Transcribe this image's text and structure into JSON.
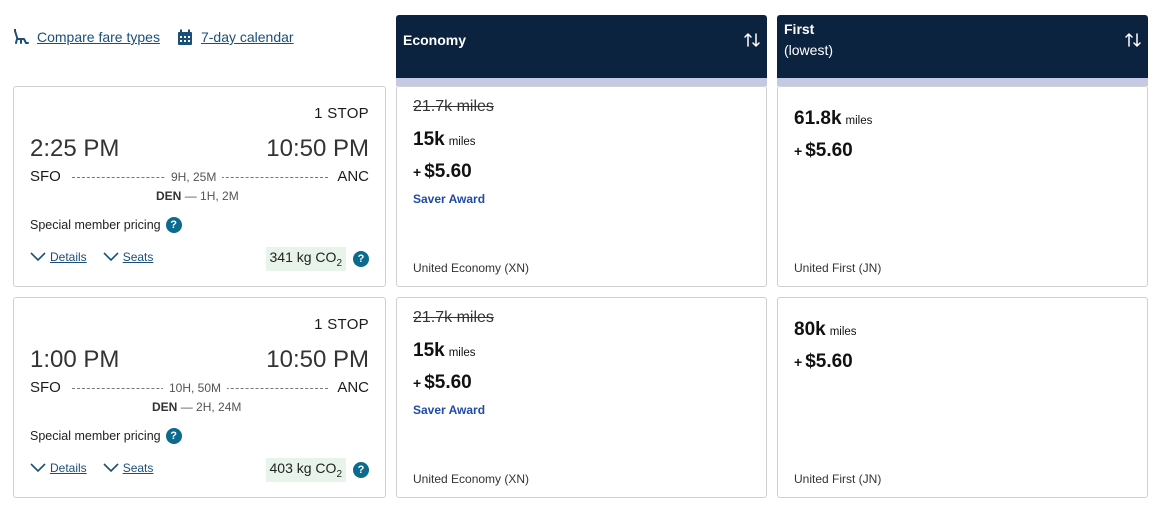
{
  "top_links": {
    "compare_fare_types": "Compare fare types",
    "seven_day_calendar": "7-day calendar"
  },
  "columns": {
    "economy": {
      "title": "Economy",
      "subtitle": ""
    },
    "first": {
      "title": "First",
      "subtitle": "(lowest)"
    }
  },
  "flights": [
    {
      "stops": "1 STOP",
      "depart_time": "2:25 PM",
      "arrive_time": "10:50 PM",
      "origin": "SFO",
      "destination": "ANC",
      "duration": "9H, 25M",
      "layover_airport": "DEN",
      "layover_duration": "— 1H, 2M",
      "special_pricing": "Special member pricing",
      "details_label": "Details",
      "seats_label": "Seats",
      "co2_value": "341 kg CO",
      "co2_sub": "2",
      "economy": {
        "original_miles": "21.7k miles",
        "miles": "15k",
        "miles_unit": "miles",
        "taxes": "$5.60",
        "badge": "Saver Award",
        "cabin": "United Economy (XN)"
      },
      "first": {
        "miles": "61.8k",
        "miles_unit": "miles",
        "taxes": "$5.60",
        "cabin": "United First (JN)"
      }
    },
    {
      "stops": "1 STOP",
      "depart_time": "1:00 PM",
      "arrive_time": "10:50 PM",
      "origin": "SFO",
      "destination": "ANC",
      "duration": "10H, 50M",
      "layover_airport": "DEN",
      "layover_duration": "— 2H, 24M",
      "special_pricing": "Special member pricing",
      "details_label": "Details",
      "seats_label": "Seats",
      "co2_value": "403 kg CO",
      "co2_sub": "2",
      "economy": {
        "original_miles": "21.7k miles",
        "miles": "15k",
        "miles_unit": "miles",
        "taxes": "$5.60",
        "badge": "Saver Award",
        "cabin": "United Economy (XN)"
      },
      "first": {
        "miles": "80k",
        "miles_unit": "miles",
        "taxes": "$5.60",
        "cabin": "United First (JN)"
      }
    }
  ],
  "icons": {
    "seat": "seat-icon",
    "calendar": "calendar-icon",
    "sort": "sort-icon",
    "chevron": "chevron-down-icon",
    "help": "help-icon"
  },
  "colors": {
    "header_bg": "#0c2340",
    "header_strip": "#c6c9e3",
    "link": "#1a4f7a",
    "saver": "#1f4aa8",
    "help_badge": "#0b6a8e",
    "co2_bg": "#e8f4ea"
  }
}
